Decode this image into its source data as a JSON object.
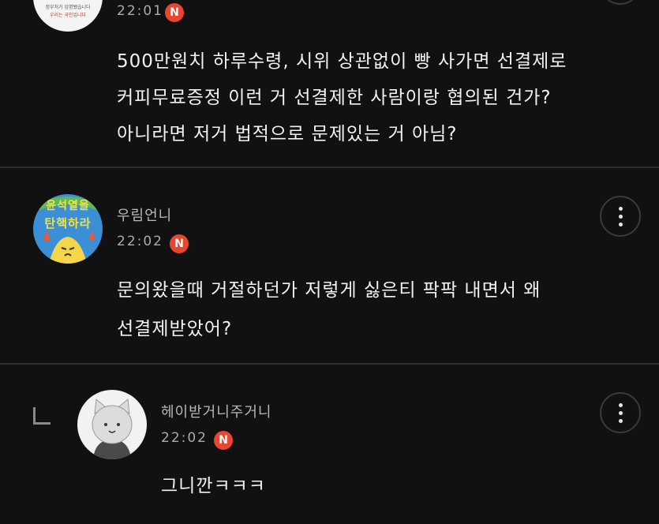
{
  "comments": [
    {
      "time": "22:01",
      "badge": "N",
      "avatar_text_top": "정부처가 임명됐습니다",
      "avatar_text_bottom": "우리는 국민입니다",
      "lines": [
        "500만원치 하루수령, 시위 상관없이 빵 사가면 선결제로",
        "커피무료증정 이런 거 선결제한 사람이랑 협의된 건가?",
        "아니라면 저거 법적으로 문제있는 거 아님?"
      ]
    },
    {
      "username": "우림언니",
      "time": "22:02",
      "badge": "N",
      "avatar_text_top": "윤석열을",
      "avatar_text_bottom": "탄핵하라",
      "lines": [
        "문의왔을때 거절하던가 저렇게 싫은티 팍팍 내면서 왜",
        "선결제받았어?"
      ]
    },
    {
      "username": "헤이받거니주거니",
      "time": "22:02",
      "badge": "N",
      "lines": [
        "그니깐ㅋㅋㅋ"
      ]
    }
  ],
  "colors": {
    "background": "#111111",
    "badge": "#e8462e",
    "avatar2_bg": "#3a8fd6",
    "avatar2_text": "#f5e23a"
  }
}
